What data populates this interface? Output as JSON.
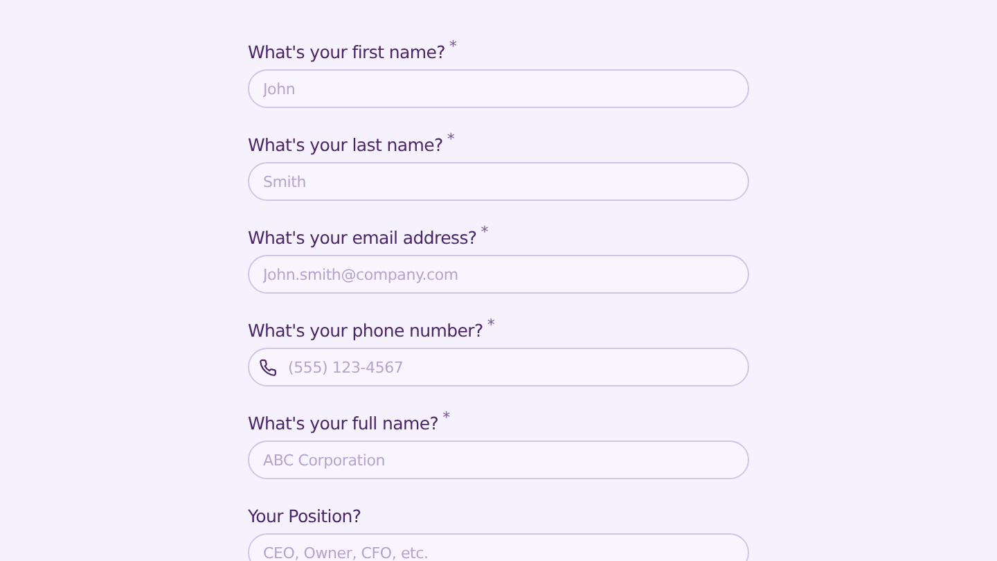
{
  "fields": [
    {
      "label": "What's your first name?",
      "mark": "*",
      "kind": "text",
      "placeholder": "John"
    },
    {
      "label": "What's your last name?",
      "mark": "*",
      "kind": "text",
      "placeholder": "Smith"
    },
    {
      "label": "What's your email address?",
      "mark": "*",
      "kind": "text",
      "placeholder": "John.smith@company.com"
    },
    {
      "label": "What's your phone number?",
      "mark": "*",
      "kind": "phone",
      "placeholder": "(555) 123-4567"
    },
    {
      "label": "What's your full name?",
      "mark": "*",
      "kind": "text",
      "placeholder": "ABC Corporation"
    },
    {
      "label": "Your Position?",
      "kind": "text",
      "placeholder": "CEO, Owner, CFO, etc."
    }
  ]
}
